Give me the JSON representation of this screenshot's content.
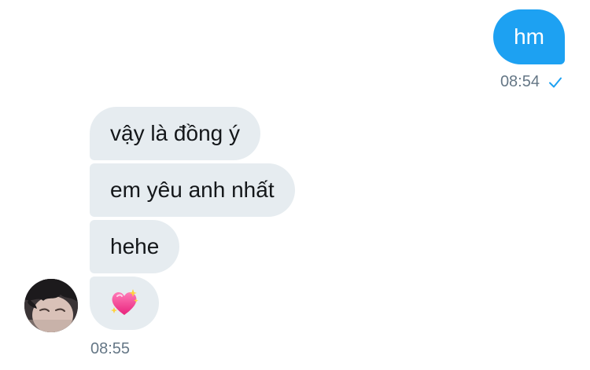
{
  "conversation": {
    "outgoing": {
      "text": "hm",
      "time": "08:54",
      "status_icon": "check-icon",
      "bubble_color": "#1da1f2"
    },
    "incoming": {
      "messages": [
        {
          "text": "vậy là đồng ý"
        },
        {
          "text": "em yêu anh nhất"
        },
        {
          "text": "hehe"
        },
        {
          "emoji": "sparkling-heart-emoji"
        }
      ],
      "time": "08:55",
      "bubble_color": "#e6ecf0"
    }
  },
  "colors": {
    "text_primary": "#14171a",
    "text_muted": "#657786",
    "accent": "#1da1f2"
  }
}
